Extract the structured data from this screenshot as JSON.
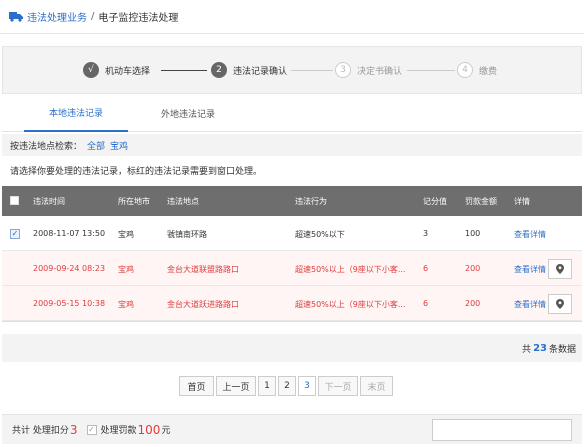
{
  "breadcrumb": {
    "root": "违法处理业务",
    "separator": "/",
    "current": "电子监控违法处理"
  },
  "steps": [
    {
      "num": "√",
      "label": "机动车选择",
      "state": "done"
    },
    {
      "num": "2",
      "label": "违法记录确认",
      "state": "active"
    },
    {
      "num": "3",
      "label": "决定书确认",
      "state": "todo"
    },
    {
      "num": "4",
      "label": "缴费",
      "state": "todo"
    }
  ],
  "tabs": [
    {
      "label": "本地违法记录"
    },
    {
      "label": "外地违法记录"
    }
  ],
  "filter": {
    "label": "按违法地点检索：",
    "options": [
      "全部",
      "宝鸡"
    ]
  },
  "notice": "请选择你要处理的违法记录，标红的违法记录需要到窗口处理。",
  "table": {
    "headers": [
      "违法时间",
      "所在地市",
      "违法地点",
      "违法行为",
      "记分值",
      "罚款金额",
      "详情"
    ],
    "detail_label": "查看详情",
    "rows": [
      {
        "time": "2008-11-07 13:50",
        "city": "宝鸡",
        "place": "虢镇南环路",
        "act": "超速50%以下",
        "points": "3",
        "fine": "100",
        "checked": "✓",
        "alert": false
      },
      {
        "time": "2009-09-24 08:23",
        "city": "宝鸡",
        "place": "金台大道联盟路路口",
        "act": "超速50%以上（9座以下小客...",
        "points": "6",
        "fine": "200",
        "checked": "",
        "alert": true
      },
      {
        "time": "2009-05-15 10:38",
        "city": "宝鸡",
        "place": "金台大道跃进路路口",
        "act": "超速50%以上（9座以下小客...",
        "points": "6",
        "fine": "200",
        "checked": "",
        "alert": true
      }
    ]
  },
  "summary": {
    "prefix": "共",
    "count": "23",
    "suffix": "条数据"
  },
  "pager": {
    "first": "首页",
    "prev": "上一页",
    "pages": [
      "1",
      "2",
      "3"
    ],
    "current": "3",
    "next": "下一页",
    "last": "末页"
  },
  "footer": {
    "prefix": "共计 处理扣分",
    "points": "3",
    "fine_prefix": "处理罚款",
    "fine": "100",
    "unit": "元"
  },
  "colors": {
    "accent": "#2a6fc9",
    "alert": "#e03c3c",
    "header_bg": "#6e6e6e",
    "panel_bg": "#f3f3f3"
  },
  "icons": {
    "breadcrumb": "truck-icon",
    "map": "map-pin-icon",
    "check": "checkmark-icon"
  }
}
